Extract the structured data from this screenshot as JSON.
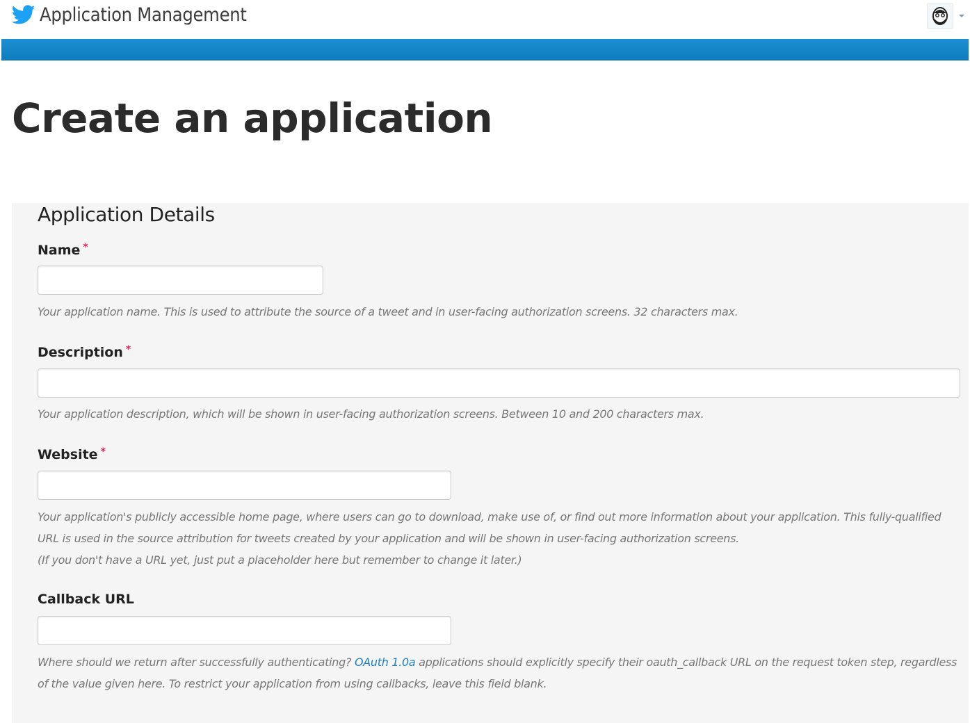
{
  "header": {
    "logo_icon": "twitter-bird-icon",
    "brand_color": "#1da1f2",
    "title": "Application Management",
    "avatar_icon": "user-avatar-icon",
    "menu_icon": "caret-down-icon",
    "bar_color": "#0e7dbf"
  },
  "page": {
    "title": "Create an application"
  },
  "details": {
    "title": "Application Details",
    "required_marker": "*",
    "fields": {
      "name": {
        "label": "Name",
        "value": "",
        "help": "Your application name. This is used to attribute the source of a tweet and in user-facing authorization screens. 32 characters max."
      },
      "description": {
        "label": "Description",
        "value": "",
        "help": "Your application description, which will be shown in user-facing authorization screens. Between 10 and 200 characters max."
      },
      "website": {
        "label": "Website",
        "value": "",
        "help_line1": "Your application's publicly accessible home page, where users can go to download, make use of, or find out more information about your application. This fully-qualified URL is used in the source attribution for tweets created by your application and will be shown in user-facing authorization screens.",
        "help_line2": "(If you don't have a URL yet, just put a placeholder here but remember to change it later.)"
      },
      "callback": {
        "label": "Callback URL",
        "value": "",
        "help_before": "Where should we return after successfully authenticating? ",
        "help_link": "OAuth 1.0a",
        "help_after": " applications should explicitly specify their oauth_callback URL on the request token step, regardless of the value given here. To restrict your application from using callbacks, leave this field blank."
      }
    }
  }
}
